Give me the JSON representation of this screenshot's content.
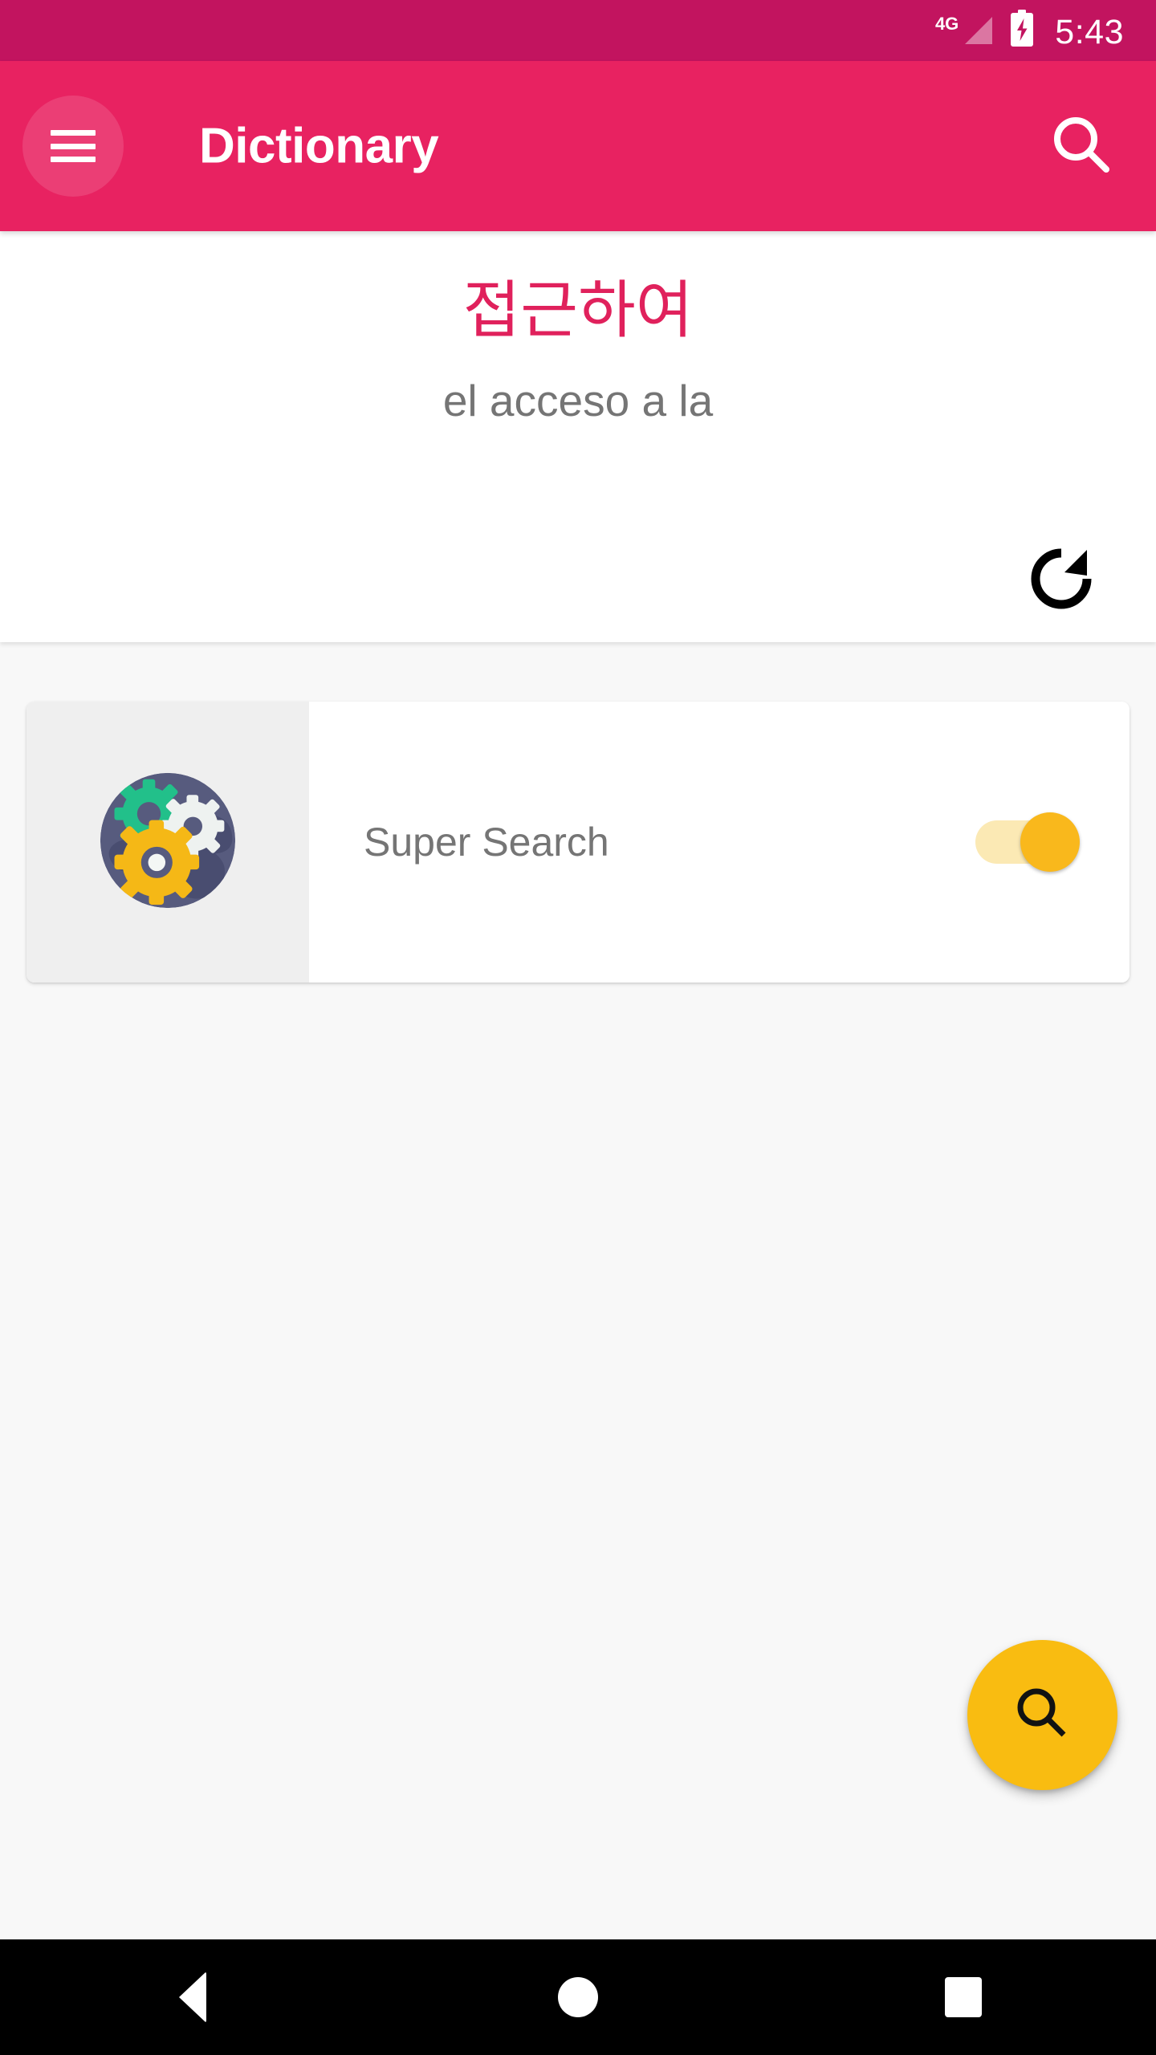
{
  "status_bar": {
    "network_label": "4G",
    "signal_icon": "signal-bars-icon",
    "battery_icon": "battery-charging-icon",
    "time": "5:43",
    "background_color": "#C2145F"
  },
  "app_bar": {
    "menu_icon": "hamburger-menu-icon",
    "title": "Dictionary",
    "search_icon": "search-icon",
    "background_color": "#E82261"
  },
  "word_panel": {
    "term": "접근하여",
    "term_color": "#E0215C",
    "translation": "el acceso a la",
    "translation_color": "#757575",
    "refresh_icon": "refresh-icon"
  },
  "setting_card": {
    "icon_name": "gears-globe-icon",
    "label": "Super Search",
    "toggle": {
      "name": "super-search-toggle",
      "state": "on",
      "track_color": "#FBE9B4",
      "thumb_color": "#F9B81C"
    }
  },
  "fab": {
    "icon": "search-icon",
    "color": "#F9BC11"
  },
  "nav_bar": {
    "back_label": "Back",
    "home_label": "Home",
    "recents_label": "Recents",
    "background_color": "#000000"
  }
}
